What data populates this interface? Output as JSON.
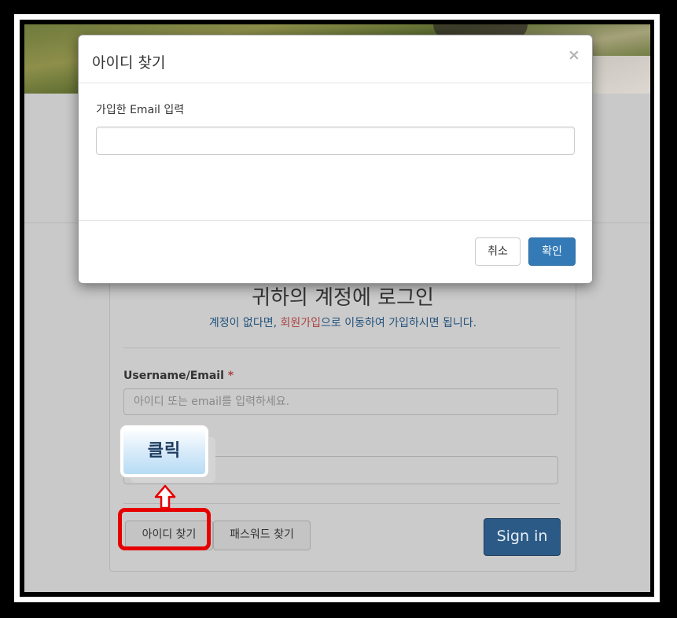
{
  "modal": {
    "title": "아이디 찾기",
    "close_glyph": "×",
    "email_label": "가입한 Email 입력",
    "email_value": "",
    "cancel_label": "취소",
    "ok_label": "확인"
  },
  "login": {
    "title": "귀하의 계정에 로그인",
    "subtitle_pre": "계정이 없다면, ",
    "subtitle_link": "회원가입",
    "subtitle_post": "으로 이동하여 가입하시면 됩니다.",
    "username_label": "Username/Email",
    "required_mark": "*",
    "username_placeholder": "아이디 또는 email를 입력하세요.",
    "find_id_label": "아이디 찾기",
    "find_pw_label": "패스워드 찾기",
    "signin_label": "Sign in"
  },
  "annotation": {
    "callout_text": "클릭",
    "highlight_color": "#e60000"
  },
  "colors": {
    "primary": "#337ab7",
    "signin_dimmed": "#2b5a86",
    "link": "#23527c",
    "link_alt": "#a94442"
  }
}
